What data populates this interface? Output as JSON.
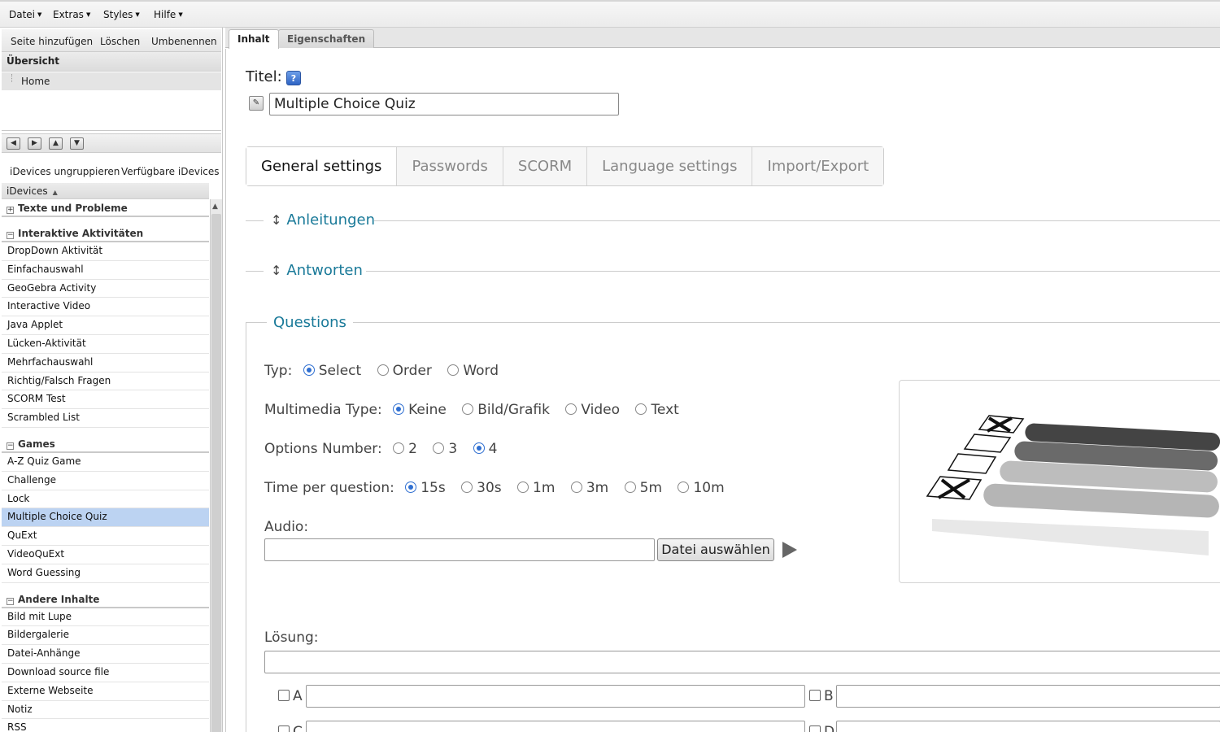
{
  "menu": {
    "items": [
      {
        "label": "Datei"
      },
      {
        "label": "Extras"
      },
      {
        "label": "Styles"
      },
      {
        "label": "Hilfe"
      }
    ]
  },
  "outline": {
    "toolbar": {
      "add": "Seite hinzufügen",
      "delete": "Löschen",
      "rename": "Umbenennen"
    },
    "header": "Übersicht",
    "home": "Home"
  },
  "idevices": {
    "toolbar": {
      "ungroup": "iDevices ungruppieren",
      "available": "Verfügbare iDevices"
    },
    "header": "iDevices",
    "groups": [
      {
        "name": "Texte und Probleme",
        "collapsed": true,
        "items": []
      },
      {
        "name": "Interaktive Aktivitäten",
        "collapsed": false,
        "items": [
          "DropDown Aktivität",
          "Einfachauswahl",
          "GeoGebra Activity",
          "Interactive Video",
          "Java Applet",
          "Lücken-Aktivität",
          "Mehrfachauswahl",
          "Richtig/Falsch Fragen",
          "SCORM Test",
          "Scrambled List"
        ]
      },
      {
        "name": "Games",
        "collapsed": false,
        "items": [
          "A-Z Quiz Game",
          "Challenge",
          "Lock",
          "Multiple Choice Quiz",
          "QuExt",
          "VideoQuExt",
          "Word Guessing"
        ]
      },
      {
        "name": "Andere Inhalte",
        "collapsed": false,
        "items": [
          "Bild mit Lupe",
          "Bildergalerie",
          "Datei-Anhänge",
          "Download source file",
          "Externe Webseite",
          "Notiz",
          "RSS"
        ]
      }
    ],
    "selected": "Multiple Choice Quiz"
  },
  "tabs": {
    "content": "Inhalt",
    "properties": "Eigenschaften"
  },
  "editor": {
    "title_label": "Titel:",
    "title_value": "Multiple Choice Quiz",
    "settings_tabs": [
      "General settings",
      "Passwords",
      "SCORM",
      "Language settings",
      "Import/Export"
    ],
    "sections": {
      "instructions": "Anleitungen",
      "answers": "Antworten",
      "questions": "Questions"
    },
    "type": {
      "label": "Typ:",
      "options": [
        "Select",
        "Order",
        "Word"
      ],
      "selected": "Select"
    },
    "multimedia": {
      "label": "Multimedia Type:",
      "options": [
        "Keine",
        "Bild/Grafik",
        "Video",
        "Text"
      ],
      "selected": "Keine"
    },
    "options_number": {
      "label": "Options Number:",
      "options": [
        "2",
        "3",
        "4"
      ],
      "selected": "4"
    },
    "time": {
      "label": "Time per question:",
      "options": [
        "15s",
        "30s",
        "1m",
        "3m",
        "5m",
        "10m"
      ],
      "selected": "15s"
    },
    "audio": {
      "label": "Audio:",
      "button": "Datei auswählen",
      "value": ""
    },
    "solution": {
      "label": "Lösung:",
      "value": ""
    },
    "answers": [
      {
        "letter": "A"
      },
      {
        "letter": "B"
      },
      {
        "letter": "C"
      },
      {
        "letter": "D"
      }
    ]
  },
  "colors": {
    "link": "#1a7a99",
    "selected_row": "#bcd3f2",
    "radio": "#2f6fd1"
  },
  "icons": [
    "help-icon",
    "edit-icon",
    "play-icon",
    "arrow-left-icon",
    "arrow-right-icon",
    "arrow-up-icon",
    "arrow-down-icon",
    "collapse-icon",
    "expand-icon"
  ]
}
